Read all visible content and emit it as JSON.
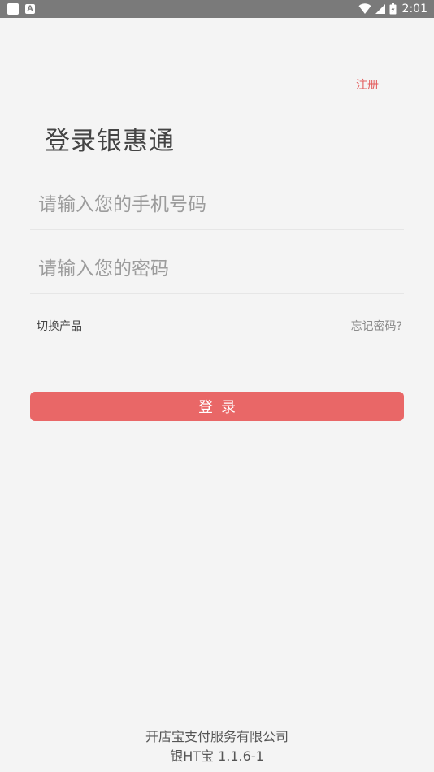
{
  "status_bar": {
    "time": "2:01",
    "left_icons": [
      "notification-square-icon",
      "app-a-icon"
    ],
    "right_icons": [
      "wifi-icon",
      "signal-icon",
      "battery-icon"
    ]
  },
  "header": {
    "register_label": "注册"
  },
  "main": {
    "title": "登录银惠通",
    "phone_placeholder": "请输入您的手机号码",
    "phone_value": "",
    "password_placeholder": "请输入您的密码",
    "password_value": "",
    "switch_product_label": "切换产品",
    "forgot_password_label": "忘记密码?",
    "login_button_label": "登录"
  },
  "footer": {
    "company": "开店宝支付服务有限公司",
    "version": "银HT宝 1.1.6-1"
  },
  "colors": {
    "background": "#f4f4f4",
    "accent": "#e96767",
    "register_text": "#e35d5d",
    "status_bar": "#7a7a7a"
  }
}
